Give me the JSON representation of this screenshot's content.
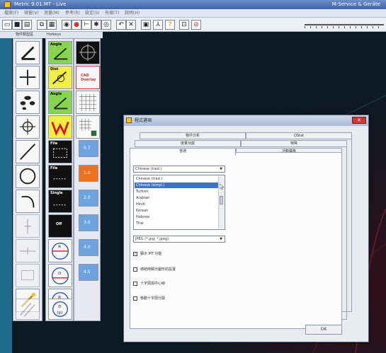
{
  "window": {
    "title": "Metric 9.01.MT - Live",
    "right_text": "M-Service & Geräte"
  },
  "menu": {
    "items": [
      "檔案(F)",
      "視窗(V)",
      "測量(M)",
      "參考(R)",
      "設定(S)",
      "有幾(T)",
      "說明(H)"
    ]
  },
  "panels": {
    "label_1": "物件類型區",
    "label_2": "Hotkeys"
  },
  "hotkeys": {
    "angle": "Angle",
    "dist": "Dist",
    "angle2": "Angle",
    "calib": "CAD Overlay",
    "file": "File",
    "file2": "File",
    "single": "Single",
    "off": "Off"
  },
  "zoom_levels": [
    "0.7",
    "1.0",
    "2.0",
    "3.0",
    "4.0",
    "4.5"
  ],
  "dialog": {
    "title": "程式選項",
    "close": "✕",
    "tabs_back": [
      "物件分析",
      "QStat"
    ],
    "tabs_mid": [
      "度量功能",
      "特殊"
    ],
    "tabs_front": [
      "普通",
      "活動攝像"
    ],
    "language_selected": "Chinese (trad.)",
    "language_options": [
      "Chinese (trad.)",
      "Chinese (simpl.)",
      "Turkish",
      "Arabian",
      "Hindi",
      "Korean",
      "Hebrew",
      "Thai"
    ],
    "image_format": "JPEG (*.jpg; *.jpeg)",
    "checkboxes": [
      {
        "label": "顯示 MT 功能",
        "checked": true,
        "mark": "✓"
      },
      {
        "label": "總結時顯示圖形的設置",
        "checked": false,
        "mark": ""
      },
      {
        "label": "十字頭與中心線",
        "checked": false,
        "mark": ""
      },
      {
        "label": "移動十字頭分開",
        "checked": false,
        "mark": ""
      }
    ],
    "ok": "OK"
  },
  "colors": {
    "titlebar": "#3d62a8",
    "selection": "#3f73c5",
    "zoom_active": "#f0721f",
    "zoom_normal": "#6da4e0"
  }
}
